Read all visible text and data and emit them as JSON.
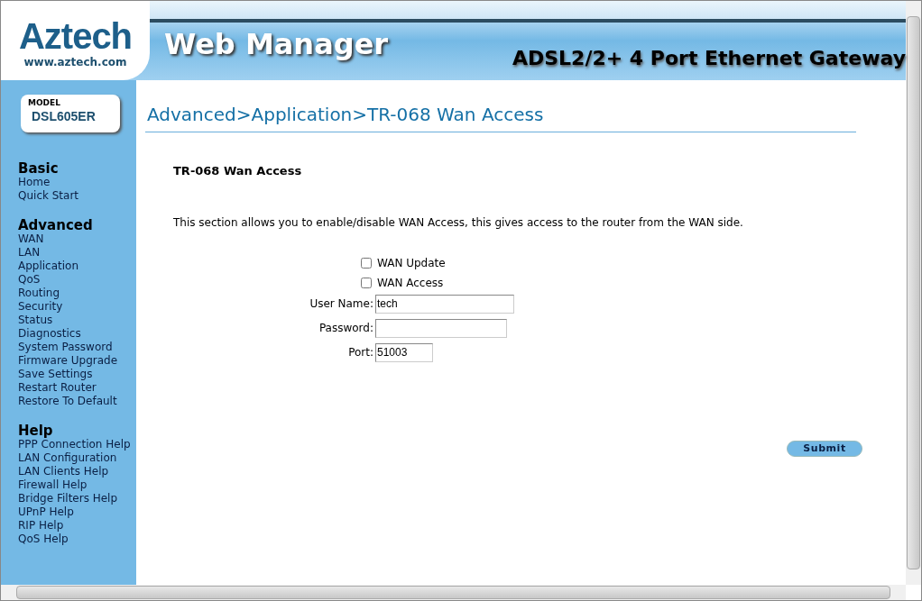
{
  "header": {
    "brand": "Aztech",
    "brand_url": "www.aztech.com",
    "title": "Web Manager",
    "product": "ADSL2/2+ 4 Port Ethernet Gateway"
  },
  "model": {
    "label": "MODEL",
    "name": "DSL605ER"
  },
  "sidebar": [
    {
      "heading": "Basic",
      "items": [
        "Home",
        "Quick Start"
      ]
    },
    {
      "heading": "Advanced",
      "items": [
        "WAN",
        "LAN",
        "Application",
        "QoS",
        "Routing",
        "Security",
        "Status",
        "Diagnostics",
        "System Password",
        "Firmware Upgrade",
        "Save Settings",
        "Restart Router",
        "Restore To Default"
      ]
    },
    {
      "heading": "Help",
      "items": [
        "PPP Connection Help",
        "LAN Configuration",
        "LAN Clients Help",
        "Firewall Help",
        "Bridge Filters Help",
        "UPnP Help",
        "RIP Help",
        "QoS Help"
      ]
    }
  ],
  "page_title": "Advanced>Application>TR-068 Wan Access",
  "section_title": "TR-068 Wan Access",
  "description": "This section allows you to enable/disable WAN Access, this gives access to the router from the WAN side.",
  "checkboxes": [
    {
      "label": "WAN Update",
      "checked": false
    },
    {
      "label": "WAN Access",
      "checked": false
    }
  ],
  "fields": [
    {
      "label": "User Name:",
      "value": "tech"
    },
    {
      "label": "Password:"
    },
    {
      "label": "Port:",
      "value": "51003"
    }
  ],
  "submit": "Submit"
}
